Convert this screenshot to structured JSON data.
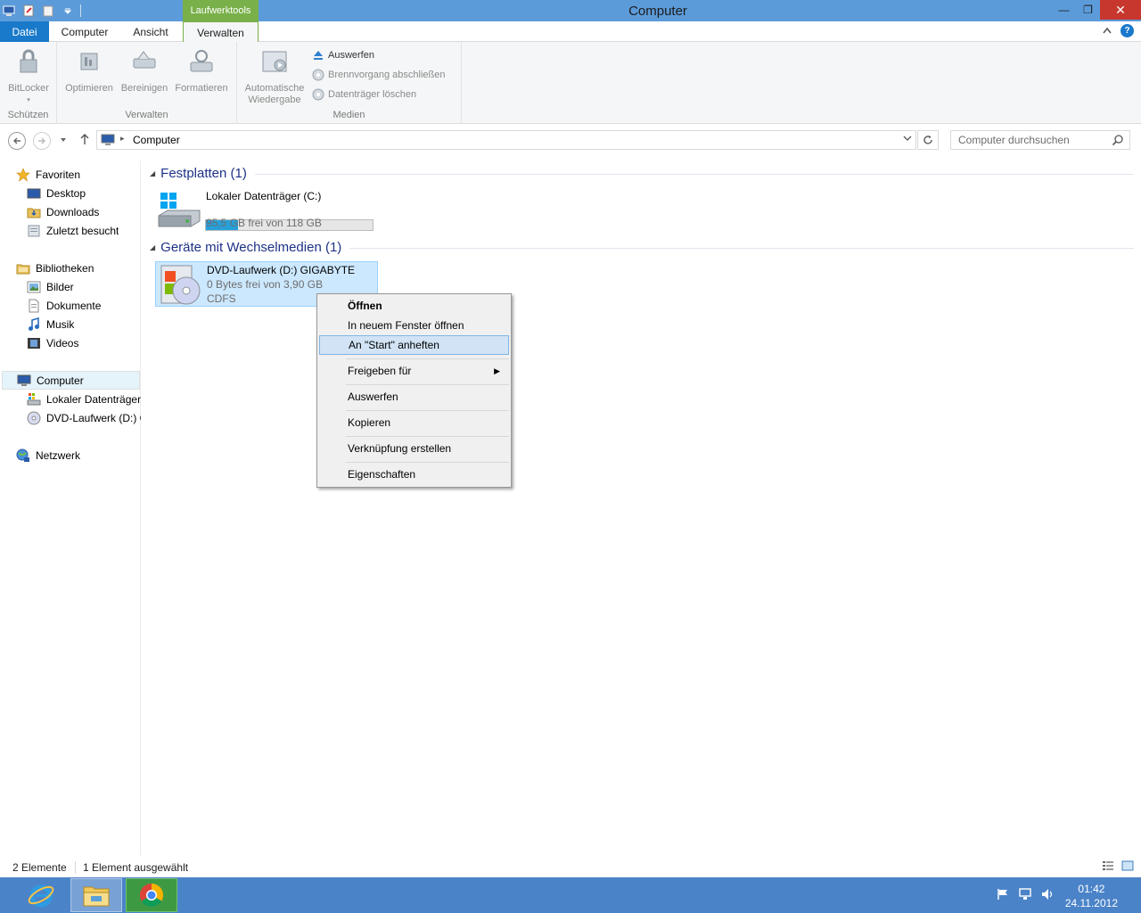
{
  "window": {
    "title": "Computer",
    "context_tab": "Laufwerktools",
    "minimize": "—",
    "maximize": "❐",
    "close": "✕"
  },
  "ribbon_tabs": {
    "file": "Datei",
    "computer": "Computer",
    "ansicht": "Ansicht",
    "verwalten": "Verwalten",
    "help": "?"
  },
  "ribbon": {
    "groups": {
      "schuetzen": "Schützen",
      "verwalten": "Verwalten",
      "medien": "Medien"
    },
    "bitlocker": "BitLocker",
    "optimieren": "Optimieren",
    "bereinigen": "Bereinigen",
    "formatieren": "Formatieren",
    "autoplay_1": "Automatische",
    "autoplay_2": "Wiedergabe",
    "auswerfen": "Auswerfen",
    "brennvorgang": "Brennvorgang abschließen",
    "datentraeger_loeschen": "Datenträger löschen"
  },
  "address": {
    "path": "Computer",
    "search_placeholder": "Computer durchsuchen"
  },
  "nav": {
    "favoriten": "Favoriten",
    "desktop": "Desktop",
    "downloads": "Downloads",
    "zuletzt": "Zuletzt besucht",
    "bibliotheken": "Bibliotheken",
    "bilder": "Bilder",
    "dokumente": "Dokumente",
    "musik": "Musik",
    "videos": "Videos",
    "computer": "Computer",
    "lokaler": "Lokaler Datenträger",
    "dvd": "DVD-Laufwerk (D:) GIGABYTE",
    "netzwerk": "Netzwerk"
  },
  "content": {
    "group1": "Festplatten (1)",
    "group2": "Geräte mit Wechselmedien (1)",
    "drive_c": {
      "name": "Lokaler Datenträger (C:)",
      "space": "95,5 GB frei von 118 GB",
      "used_fraction": 0.19
    },
    "drive_d": {
      "name": "DVD-Laufwerk (D:) GIGABYTE",
      "space": "0 Bytes frei von 3,90 GB",
      "fs": "CDFS"
    }
  },
  "context_menu": {
    "oeffnen": "Öffnen",
    "neues_fenster": "In neuem Fenster öffnen",
    "anheften": "An \"Start\" anheften",
    "freigeben": "Freigeben für",
    "auswerfen": "Auswerfen",
    "kopieren": "Kopieren",
    "verknuepfung": "Verknüpfung erstellen",
    "eigenschaften": "Eigenschaften"
  },
  "status": {
    "count": "2 Elemente",
    "selected": "1 Element ausgewählt"
  },
  "taskbar": {
    "time": "01:42",
    "date": "24.11.2012"
  },
  "colors": {
    "titlebar": "#5c9bd9",
    "context_tab": "#79b04a",
    "file_tab": "#1979ca",
    "taskbar": "#4b83c8",
    "selection": "#cce8ff",
    "group_header": "#1e3287"
  }
}
